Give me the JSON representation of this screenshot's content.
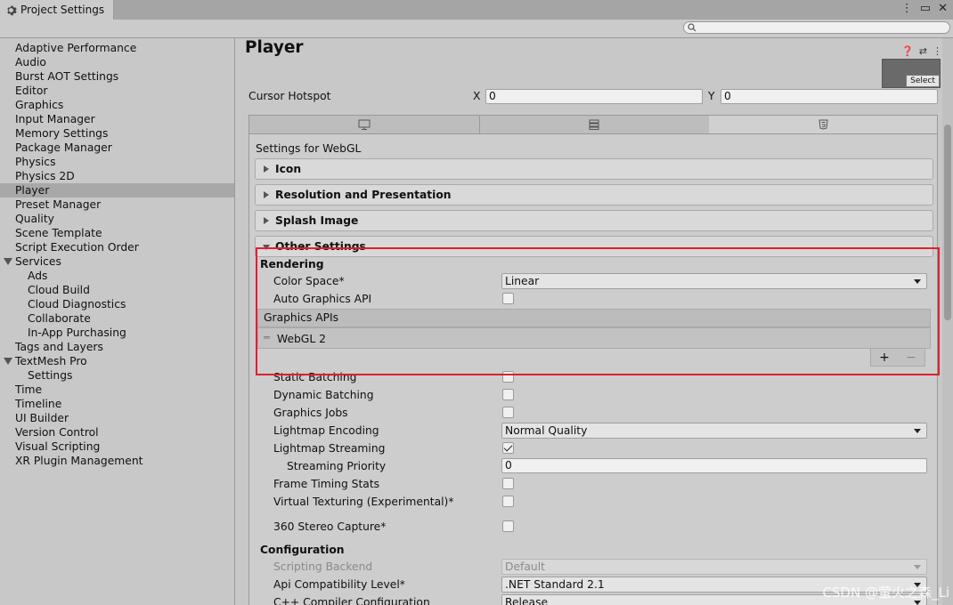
{
  "window": {
    "tab_title": "Project Settings"
  },
  "sidebar": {
    "items": [
      {
        "label": "Adaptive Performance"
      },
      {
        "label": "Audio"
      },
      {
        "label": "Burst AOT Settings"
      },
      {
        "label": "Editor"
      },
      {
        "label": "Graphics"
      },
      {
        "label": "Input Manager"
      },
      {
        "label": "Memory Settings"
      },
      {
        "label": "Package Manager"
      },
      {
        "label": "Physics"
      },
      {
        "label": "Physics 2D"
      },
      {
        "label": "Player"
      },
      {
        "label": "Preset Manager"
      },
      {
        "label": "Quality"
      },
      {
        "label": "Scene Template"
      },
      {
        "label": "Script Execution Order"
      },
      {
        "label": "Services"
      },
      {
        "label": "Ads"
      },
      {
        "label": "Cloud Build"
      },
      {
        "label": "Cloud Diagnostics"
      },
      {
        "label": "Collaborate"
      },
      {
        "label": "In-App Purchasing"
      },
      {
        "label": "Tags and Layers"
      },
      {
        "label": "TextMesh Pro"
      },
      {
        "label": "Settings"
      },
      {
        "label": "Time"
      },
      {
        "label": "Timeline"
      },
      {
        "label": "UI Builder"
      },
      {
        "label": "Version Control"
      },
      {
        "label": "Visual Scripting"
      },
      {
        "label": "XR Plugin Management"
      }
    ]
  },
  "player": {
    "title": "Player",
    "thumb_select": "Select",
    "cursor_hotspot": {
      "label": "Cursor Hotspot",
      "x_label": "X",
      "x": "0",
      "y_label": "Y",
      "y": "0"
    },
    "settings_for": "Settings for WebGL",
    "sections": {
      "icon": "Icon",
      "resolution": "Resolution and Presentation",
      "splash": "Splash Image",
      "other": "Other Settings"
    },
    "rendering": {
      "header": "Rendering",
      "color_space_label": "Color Space*",
      "color_space": "Linear",
      "auto_graphics_api": "Auto Graphics API",
      "graphics_apis_header": "Graphics APIs",
      "graphics_api_item": "WebGL 2",
      "add": "+",
      "remove": "−",
      "static_batching": "Static Batching",
      "dynamic_batching": "Dynamic Batching",
      "graphics_jobs": "Graphics Jobs",
      "lightmap_encoding_label": "Lightmap Encoding",
      "lightmap_encoding": "Normal Quality",
      "lightmap_streaming": "Lightmap Streaming",
      "streaming_priority_label": "Streaming Priority",
      "streaming_priority": "0",
      "frame_timing_stats": "Frame Timing Stats",
      "virtual_texturing": "Virtual Texturing (Experimental)*",
      "stereo_capture": "360 Stereo Capture*"
    },
    "configuration": {
      "header": "Configuration",
      "scripting_backend_label": "Scripting Backend",
      "scripting_backend": "Default",
      "api_compat_label": "Api Compatibility Level*",
      "api_compat": ".NET Standard 2.1",
      "cpp_compiler_label": "C++ Compiler Configuration",
      "cpp_compiler": "Release"
    }
  },
  "watermark": "CSDN @萤火之森_Li",
  "colors": {
    "highlight": "#e0202e",
    "selected": "#a8a8a8"
  }
}
